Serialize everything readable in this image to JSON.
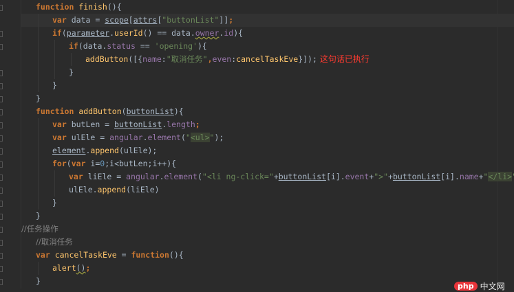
{
  "lines": [
    {
      "indent": 1,
      "tokens": [
        [
          "kw",
          "function "
        ],
        [
          "fn",
          "finish"
        ],
        [
          "",
          "(){"
        ]
      ]
    },
    {
      "indent": 2,
      "hl": true,
      "tokens": [
        [
          "kw",
          "var "
        ],
        [
          "",
          "data = "
        ],
        [
          "ul",
          "scope"
        ],
        [
          "",
          "["
        ],
        [
          "ul",
          "attrs"
        ],
        [
          "",
          "["
        ],
        [
          "str",
          "\"buttonList\""
        ],
        [
          "",
          "]]"
        ],
        [
          "kw",
          ";"
        ]
      ]
    },
    {
      "indent": 2,
      "tokens": [
        [
          "kw",
          "if"
        ],
        [
          "",
          "("
        ],
        [
          "ul",
          "parameter"
        ],
        [
          "",
          "."
        ],
        [
          "fn",
          "userId"
        ],
        [
          "",
          "() == data."
        ],
        [
          "wv fld",
          "owner"
        ],
        [
          "",
          "."
        ],
        [
          "fld",
          "id"
        ],
        [
          "",
          "){"
        ]
      ]
    },
    {
      "indent": 3,
      "tokens": [
        [
          "kw",
          "if"
        ],
        [
          "",
          "(data."
        ],
        [
          "fld",
          "status"
        ],
        [
          "",
          " == "
        ],
        [
          "str",
          "'opening'"
        ],
        [
          "",
          "){"
        ]
      ]
    },
    {
      "indent": 4,
      "tokens": [
        [
          "fn",
          "addButton"
        ],
        [
          "",
          "([{"
        ],
        [
          "fld",
          "name"
        ],
        [
          "",
          ":"
        ],
        [
          "str",
          "\"取消任务\""
        ],
        [
          "kw",
          ","
        ],
        [
          "fld",
          "even"
        ],
        [
          "",
          ":"
        ],
        [
          "fn",
          "cancelTaskEve"
        ],
        [
          "",
          "}]);"
        ]
      ],
      "note": "这句话已执行"
    },
    {
      "indent": 3,
      "tokens": [
        [
          "",
          "}"
        ]
      ]
    },
    {
      "indent": 2,
      "tokens": [
        [
          "",
          "}"
        ]
      ]
    },
    {
      "indent": 1,
      "tokens": [
        [
          "",
          "}"
        ]
      ]
    },
    {
      "indent": 1,
      "tokens": [
        [
          "kw",
          "function "
        ],
        [
          "fn",
          "addButton"
        ],
        [
          "",
          "("
        ],
        [
          "ul",
          "buttonList"
        ],
        [
          "",
          "){"
        ]
      ]
    },
    {
      "indent": 2,
      "tokens": [
        [
          "kw",
          "var "
        ],
        [
          "",
          "butLen = "
        ],
        [
          "ul",
          "buttonList"
        ],
        [
          "",
          "."
        ],
        [
          "fld",
          "length"
        ],
        [
          "kw",
          ";"
        ]
      ]
    },
    {
      "indent": 2,
      "tokens": [
        [
          "kw",
          "var "
        ],
        [
          "",
          "ulEle = "
        ],
        [
          "fld",
          "angular"
        ],
        [
          "",
          "."
        ],
        [
          "fld",
          "element"
        ],
        [
          "",
          "("
        ],
        [
          "str",
          "\""
        ],
        [
          "str tag",
          "<ul>"
        ],
        [
          "str",
          "\""
        ],
        [
          "",
          ");"
        ]
      ]
    },
    {
      "indent": 2,
      "tokens": [
        [
          "ul",
          "element"
        ],
        [
          "",
          "."
        ],
        [
          "fn",
          "append"
        ],
        [
          "",
          "(ulEle);"
        ]
      ]
    },
    {
      "indent": 2,
      "tokens": [
        [
          "kw",
          "for"
        ],
        [
          "",
          "("
        ],
        [
          "kw",
          "var "
        ],
        [
          "",
          "i="
        ],
        [
          "num",
          "0"
        ],
        [
          "",
          ";i<butLen;i++){"
        ]
      ]
    },
    {
      "indent": 3,
      "tokens": [
        [
          "kw",
          "var "
        ],
        [
          "",
          "liEle = "
        ],
        [
          "fld",
          "angular"
        ],
        [
          "",
          "."
        ],
        [
          "fld",
          "element"
        ],
        [
          "",
          "("
        ],
        [
          "str",
          "\"<li ng-click=\""
        ],
        [
          "",
          "+"
        ],
        [
          "ul",
          "buttonList"
        ],
        [
          "",
          "[i]."
        ],
        [
          "fld",
          "event"
        ],
        [
          "",
          "+"
        ],
        [
          "str",
          "\">\""
        ],
        [
          "",
          "+"
        ],
        [
          "ul",
          "buttonList"
        ],
        [
          "",
          "[i]."
        ],
        [
          "fld",
          "name"
        ],
        [
          "",
          "+"
        ],
        [
          "str",
          "\""
        ],
        [
          "str tag",
          "</li>"
        ],
        [
          "str",
          "\""
        ],
        [
          "",
          ");"
        ]
      ]
    },
    {
      "indent": 3,
      "tokens": [
        [
          "",
          "ulEle."
        ],
        [
          "fn",
          "append"
        ],
        [
          "",
          "(liEle)"
        ]
      ]
    },
    {
      "indent": 2,
      "tokens": [
        [
          "",
          "}"
        ]
      ]
    },
    {
      "indent": 1,
      "tokens": [
        [
          "",
          "}"
        ]
      ]
    },
    {
      "indent": 0,
      "tokens": [
        [
          "cm",
          "//任务操作"
        ]
      ]
    },
    {
      "indent": 1,
      "tokens": [
        [
          "cm",
          "//取消任务"
        ]
      ]
    },
    {
      "indent": 1,
      "tokens": [
        [
          "kw",
          "var "
        ],
        [
          "fn",
          "cancelTaskEve"
        ],
        [
          "",
          " = "
        ],
        [
          "kw",
          "function"
        ],
        [
          "",
          "(){"
        ]
      ]
    },
    {
      "indent": 2,
      "tokens": [
        [
          "fn",
          "alert"
        ],
        [
          "wv",
          "()"
        ],
        [
          "kw",
          ";"
        ]
      ]
    },
    {
      "indent": 1,
      "tokens": [
        [
          "",
          "}"
        ]
      ]
    }
  ],
  "watermark": {
    "logo": "php",
    "text": "中文网"
  }
}
